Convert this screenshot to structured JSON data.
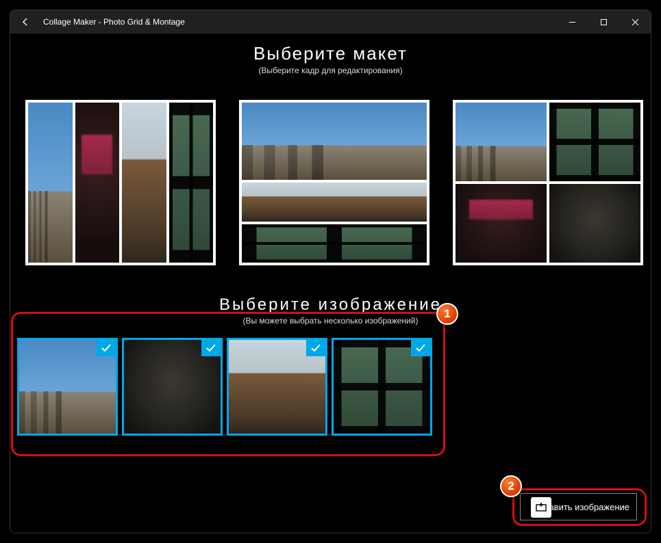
{
  "titlebar": {
    "app_title": "Collage Maker - Photo Grid & Montage"
  },
  "layout_section": {
    "heading": "Выберите макет",
    "subheading": "(Выберите кадр для редактирования)"
  },
  "image_section": {
    "heading": "Выберите изображение",
    "subheading": "(Вы можете выбрать несколько изображений)"
  },
  "thumbnails": [
    {
      "name": "city-balloons",
      "selected": true
    },
    {
      "name": "man-jacket",
      "selected": true
    },
    {
      "name": "mountain",
      "selected": true
    },
    {
      "name": "window",
      "selected": true
    }
  ],
  "callouts": {
    "one": "1",
    "two": "2"
  },
  "buttons": {
    "add_image_label": "равить изображение"
  }
}
